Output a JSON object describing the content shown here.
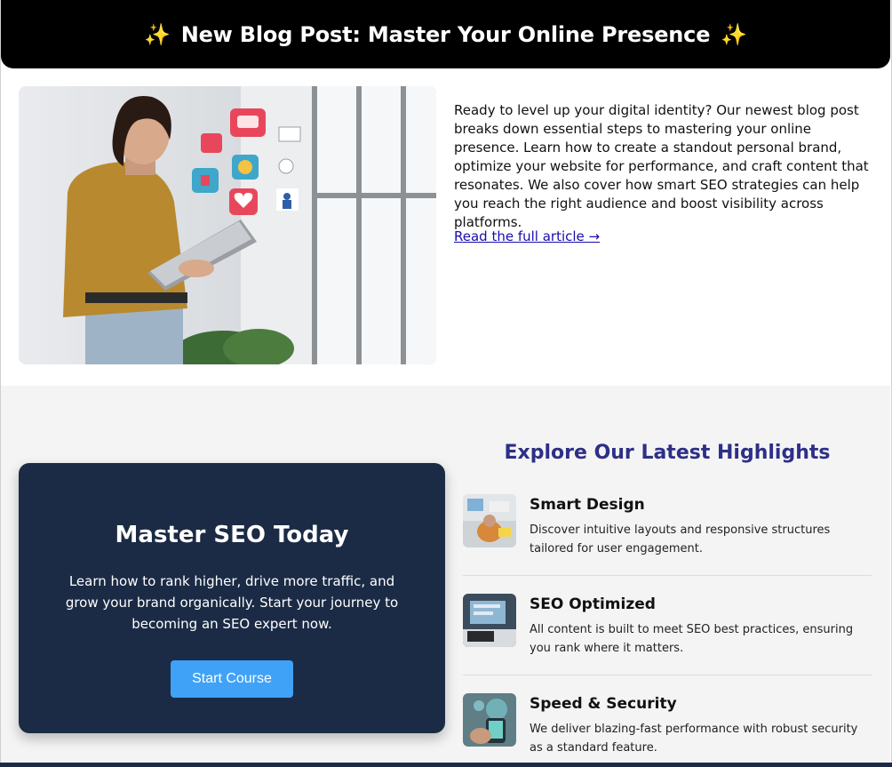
{
  "banner": {
    "sparkle_left": "✨",
    "title": "New Blog Post: Master Your Online Presence",
    "sparkle_right": "✨"
  },
  "blog": {
    "body": "Ready to level up your digital identity? Our newest blog post breaks down essential steps to mastering your online presence. Learn how to create a standout personal brand, optimize your website for performance, and craft content that resonates. We also cover how smart SEO strategies can help you reach the right audience and boost visibility across platforms.",
    "link_label": "Read the full article →"
  },
  "seo_card": {
    "title": "Master SEO Today",
    "description": "Learn how to rank higher, drive more traffic, and grow your brand organically. Start your journey to becoming an SEO expert now.",
    "button_label": "Start Course"
  },
  "highlights": {
    "title": "Explore Our Latest Highlights",
    "items": [
      {
        "name": "Smart Design",
        "description": "Discover intuitive layouts and responsive structures tailored for user engagement."
      },
      {
        "name": "SEO Optimized",
        "description": "All content is built to meet SEO best practices, ensuring you rank where it matters."
      },
      {
        "name": "Speed & Security",
        "description": "We deliver blazing-fast performance with robust security as a standard feature."
      }
    ]
  },
  "colors": {
    "banner_bg": "#000000",
    "card_bg": "#1b2b45",
    "button_bg": "#3fa2f7",
    "highlights_title": "#2e2f86",
    "link": "#1a0dab"
  }
}
